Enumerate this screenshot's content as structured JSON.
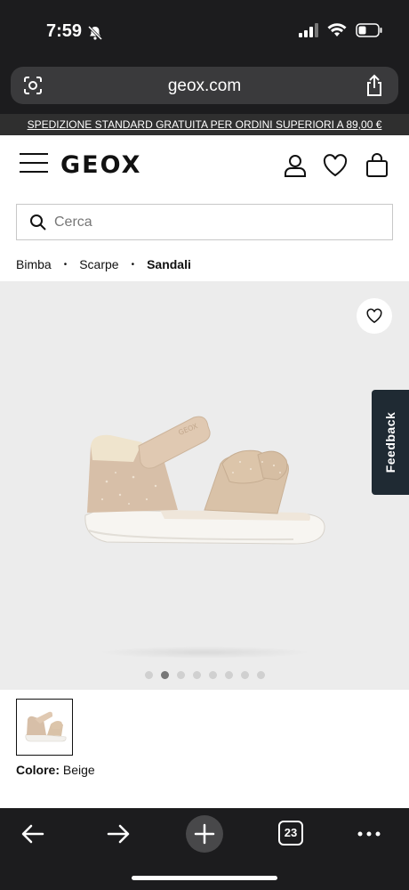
{
  "status": {
    "time": "7:59"
  },
  "browser": {
    "url": "geox.com",
    "tabs_count": "23"
  },
  "promo": {
    "text": "SPEDIZIONE STANDARD GRATUITA PER ORDINI SUPERIORI A 89,00 €"
  },
  "header": {
    "logo": "GEOX"
  },
  "search": {
    "placeholder": "Cerca"
  },
  "breadcrumb": {
    "items": [
      "Bimba",
      "Scarpe",
      "Sandali"
    ],
    "separator": "•"
  },
  "product": {
    "feedback_label": "Feedback",
    "carousel": {
      "total": 8,
      "active_index": 1
    },
    "color_label": "Colore:",
    "color_value": "Beige"
  },
  "colors": {
    "dark": "#1c1c1e",
    "promo_bg": "#2f2f2f",
    "image_bg": "#ececec",
    "feedback_bg": "#1f2a33"
  },
  "icons": [
    "bell-slash-icon",
    "signal-icon",
    "wifi-icon",
    "battery-icon",
    "lens-icon",
    "share-icon",
    "menu-icon",
    "user-icon",
    "heart-icon",
    "bag-icon",
    "search-icon",
    "back-icon",
    "forward-icon",
    "plus-icon",
    "more-icon"
  ]
}
